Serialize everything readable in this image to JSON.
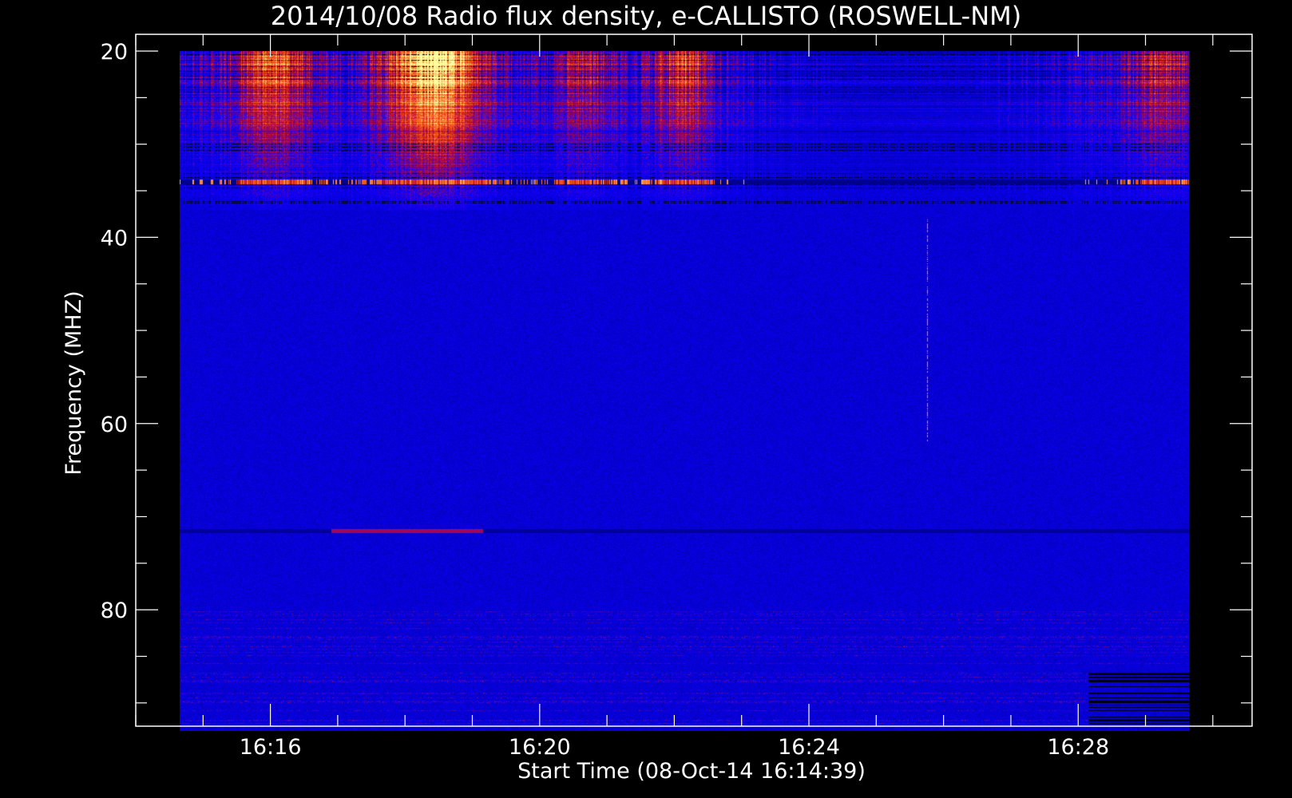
{
  "chart_data": {
    "type": "heatmap",
    "title": "2014/10/08  Radio flux density, e-CALLISTO (ROSWELL-NM)",
    "xlabel": "Start Time (08-Oct-14 16:14:39)",
    "ylabel": "Frequency (MHZ)",
    "x_start": "16:14:39",
    "x_end": "16:29:39",
    "xlim": [
      "16:14:00",
      "16:30:35"
    ],
    "x_major_ticks": [
      "16:16",
      "16:20",
      "16:24",
      "16:28"
    ],
    "x_minor_tick_step_min": 1,
    "ylim": [
      20,
      93
    ],
    "y_inverted": true,
    "y_range_displayed": [
      18.2,
      92.5
    ],
    "y_major_ticks": [
      20,
      40,
      60,
      80
    ],
    "y_minor_tick_step": 5,
    "colors": {
      "background": "#000000",
      "low": "#1a00ff",
      "mid": "#c01010",
      "high": "#ffff60",
      "axes": "#ffffff"
    },
    "features": {
      "high_intensity_band_MHz": [
        20,
        37
      ],
      "bright_horizontal_line_MHz": 34,
      "horizontal_line_MHz": 71.5,
      "vertical_spike_time": "16:25:45"
    }
  }
}
